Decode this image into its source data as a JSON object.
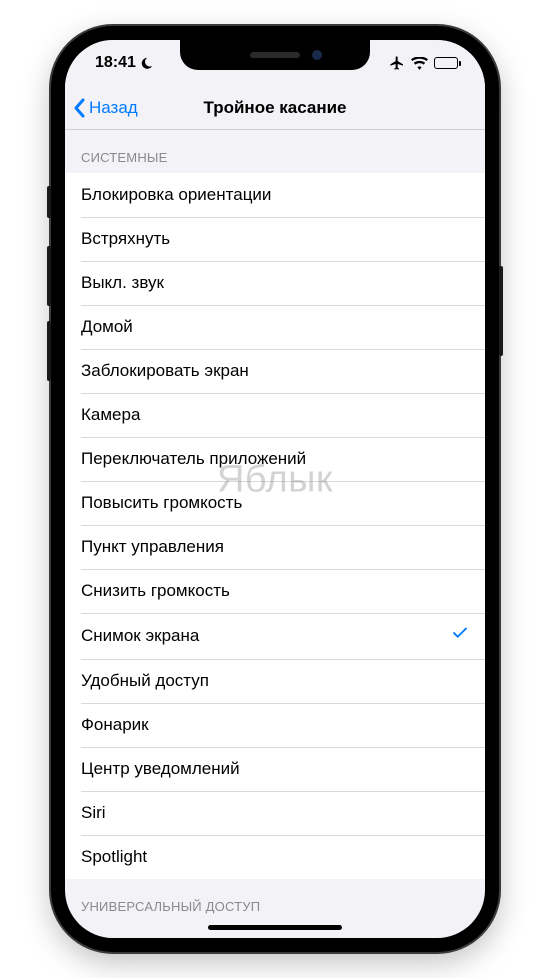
{
  "statusBar": {
    "time": "18:41"
  },
  "navBar": {
    "back": "Назад",
    "title": "Тройное касание"
  },
  "sections": [
    {
      "header": "СИСТЕМНЫЕ",
      "items": [
        {
          "label": "Блокировка ориентации",
          "checked": false
        },
        {
          "label": "Встряхнуть",
          "checked": false
        },
        {
          "label": "Выкл. звук",
          "checked": false
        },
        {
          "label": "Домой",
          "checked": false
        },
        {
          "label": "Заблокировать экран",
          "checked": false
        },
        {
          "label": "Камера",
          "checked": false
        },
        {
          "label": "Переключатель приложений",
          "checked": false
        },
        {
          "label": "Повысить громкость",
          "checked": false
        },
        {
          "label": "Пункт управления",
          "checked": false
        },
        {
          "label": "Снизить громкость",
          "checked": false
        },
        {
          "label": "Снимок экрана",
          "checked": true
        },
        {
          "label": "Удобный доступ",
          "checked": false
        },
        {
          "label": "Фонарик",
          "checked": false
        },
        {
          "label": "Центр уведомлений",
          "checked": false
        },
        {
          "label": "Siri",
          "checked": false
        },
        {
          "label": "Spotlight",
          "checked": false
        }
      ]
    },
    {
      "header": "УНИВЕРСАЛЬНЫЙ ДОСТУП",
      "items": []
    }
  ],
  "watermark": "Яблык"
}
